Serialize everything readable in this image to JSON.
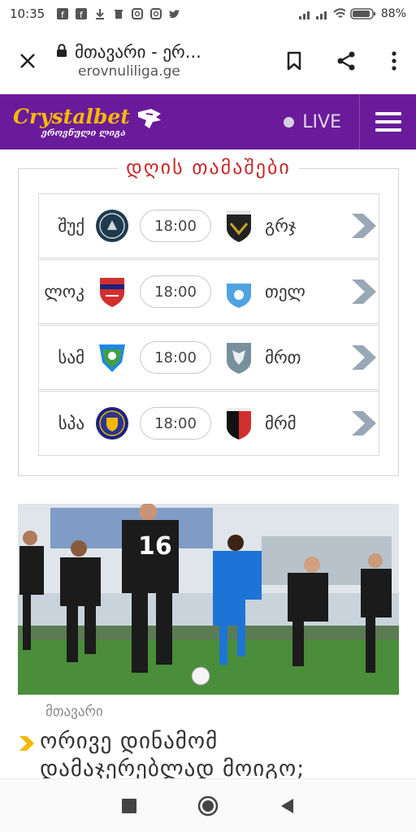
{
  "status_bar": {
    "time": "10:35",
    "battery": "88%"
  },
  "browser": {
    "title": "მთავარი - ერ...",
    "domain": "erovnuliliga.ge"
  },
  "header": {
    "logo_main": "Crystalbet",
    "logo_sub": "ეროვნული ლიგა",
    "live_label": "LIVE",
    "colors": {
      "header_bg": "#6a1b9a",
      "logo": "#f5b800",
      "accent": "#c62828"
    }
  },
  "matches": {
    "title": "დღის თამაშები",
    "rows": [
      {
        "home": "შუქ",
        "time": "18:00",
        "away": "გრჯ",
        "home_crest": "shukura-crest",
        "away_crest": "gareji-crest"
      },
      {
        "home": "ლოკ",
        "time": "18:00",
        "away": "თელ",
        "home_crest": "lokomotivi-crest",
        "away_crest": "telavi-crest"
      },
      {
        "home": "სამ",
        "time": "18:00",
        "away": "მრთ",
        "home_crest": "samgurali-crest",
        "away_crest": "merani-crest"
      },
      {
        "home": "სპა",
        "time": "18:00",
        "away": "მრმ",
        "home_crest": "saburtalo-crest",
        "away_crest": "merani-martvili-crest"
      }
    ]
  },
  "news": {
    "category": "მთავარი",
    "headline": "ორივე დინამომ დამაჯერებლად მოიგო;",
    "photo_jersey_number": "16"
  }
}
